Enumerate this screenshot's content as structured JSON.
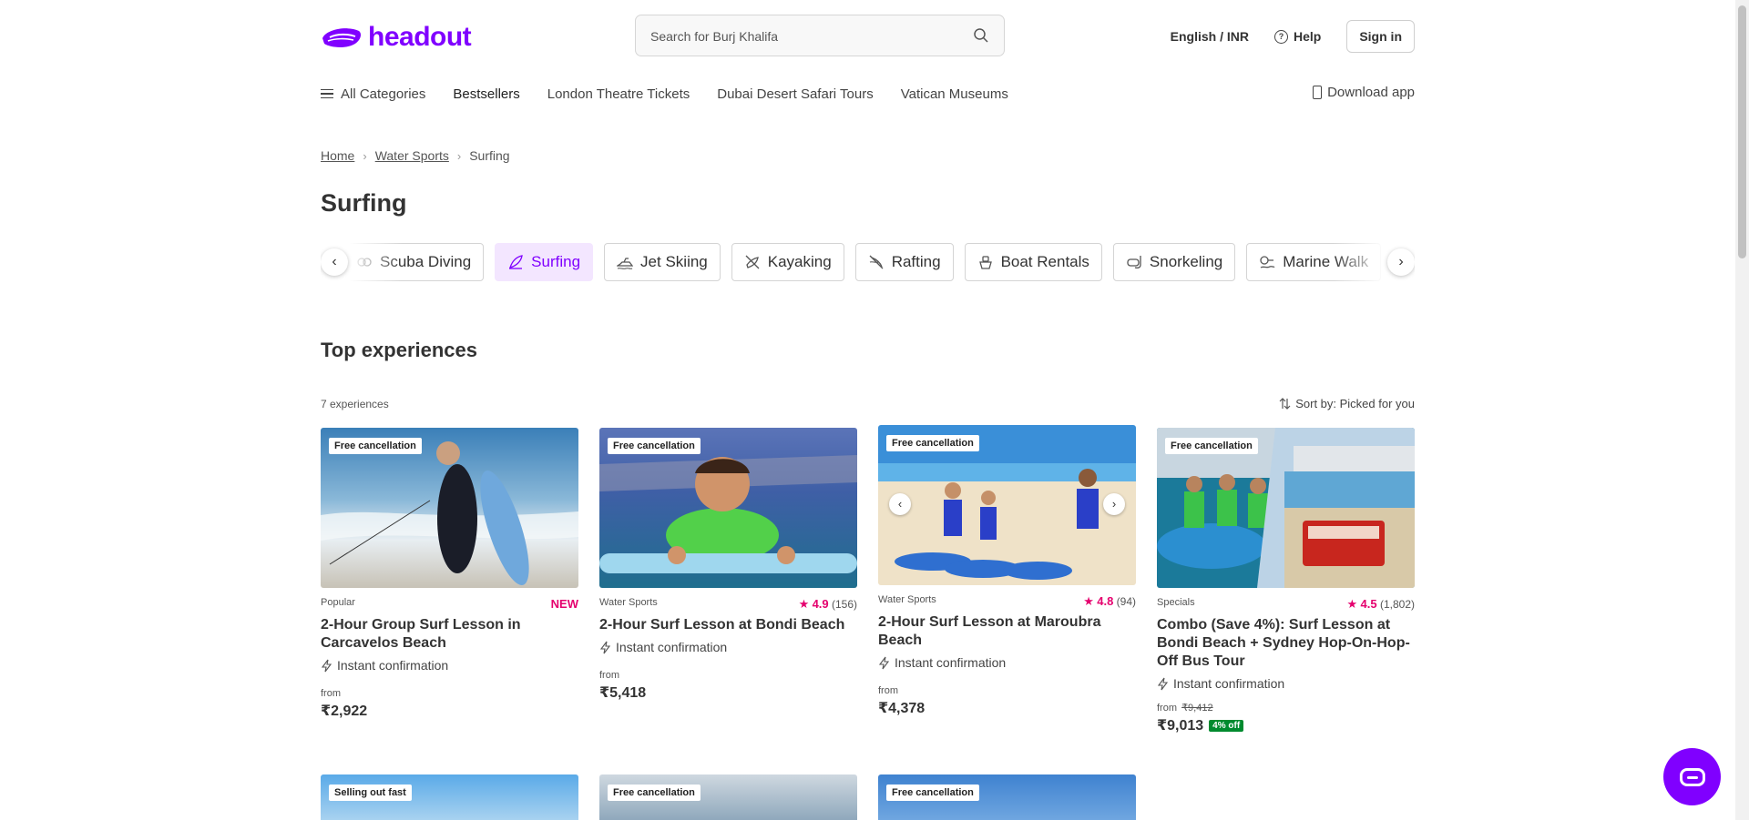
{
  "header": {
    "logo_text": "headout",
    "search_placeholder": "Search for Burj Khalifa",
    "language": "English / INR",
    "help": "Help",
    "sign_in": "Sign in"
  },
  "nav": {
    "all_categories": "All Categories",
    "items": [
      "Bestsellers",
      "London Theatre Tickets",
      "Dubai Desert Safari Tours",
      "Vatican Museums"
    ],
    "download_app": "Download app"
  },
  "breadcrumb": {
    "home": "Home",
    "parent": "Water Sports",
    "current": "Surfing"
  },
  "page_title": "Surfing",
  "categories": {
    "items": [
      {
        "label": "Scuba Diving",
        "icon": "scuba-icon"
      },
      {
        "label": "Surfing",
        "icon": "surf-icon",
        "active": true
      },
      {
        "label": "Jet Skiing",
        "icon": "jet-ski-icon"
      },
      {
        "label": "Kayaking",
        "icon": "kayak-icon"
      },
      {
        "label": "Rafting",
        "icon": "raft-icon"
      },
      {
        "label": "Boat Rentals",
        "icon": "boat-icon"
      },
      {
        "label": "Snorkeling",
        "icon": "snorkel-icon"
      },
      {
        "label": "Marine Walk",
        "icon": "marine-walk-icon"
      }
    ]
  },
  "section": {
    "title": "Top experiences",
    "count": "7 experiences",
    "sort": "Sort by: Picked for you"
  },
  "cards": [
    {
      "badge": "Free cancellation",
      "category": "Popular",
      "tag": "NEW",
      "title": "2-Hour Group Surf Lesson in Carcavelos Beach",
      "instant": "Instant confirmation",
      "from": "from",
      "price": "₹2,922"
    },
    {
      "badge": "Free cancellation",
      "category": "Water Sports",
      "rating": "4.9",
      "reviews": "(156)",
      "title": "2-Hour Surf Lesson at Bondi Beach",
      "instant": "Instant confirmation",
      "from": "from",
      "price": "₹5,418"
    },
    {
      "badge": "Free cancellation",
      "category": "Water Sports",
      "rating": "4.8",
      "reviews": "(94)",
      "title": "2-Hour Surf Lesson at Maroubra Beach",
      "instant": "Instant confirmation",
      "from": "from",
      "price": "₹4,378"
    },
    {
      "badge": "Free cancellation",
      "category": "Specials",
      "rating": "4.5",
      "reviews": "(1,802)",
      "title": "Combo (Save 4%): Surf Lesson at Bondi Beach + Sydney Hop-On-Hop-Off Bus Tour",
      "instant": "Instant confirmation",
      "from": "from",
      "original_price": "₹9,412",
      "price": "₹9,013",
      "discount": "4% off"
    }
  ],
  "cards_row2": [
    {
      "badge": "Selling out fast"
    },
    {
      "badge": "Free cancellation"
    },
    {
      "badge": "Free cancellation"
    }
  ],
  "colors": {
    "brand": "#8000ff",
    "rating": "#e5006e",
    "discount": "#008a2e"
  }
}
